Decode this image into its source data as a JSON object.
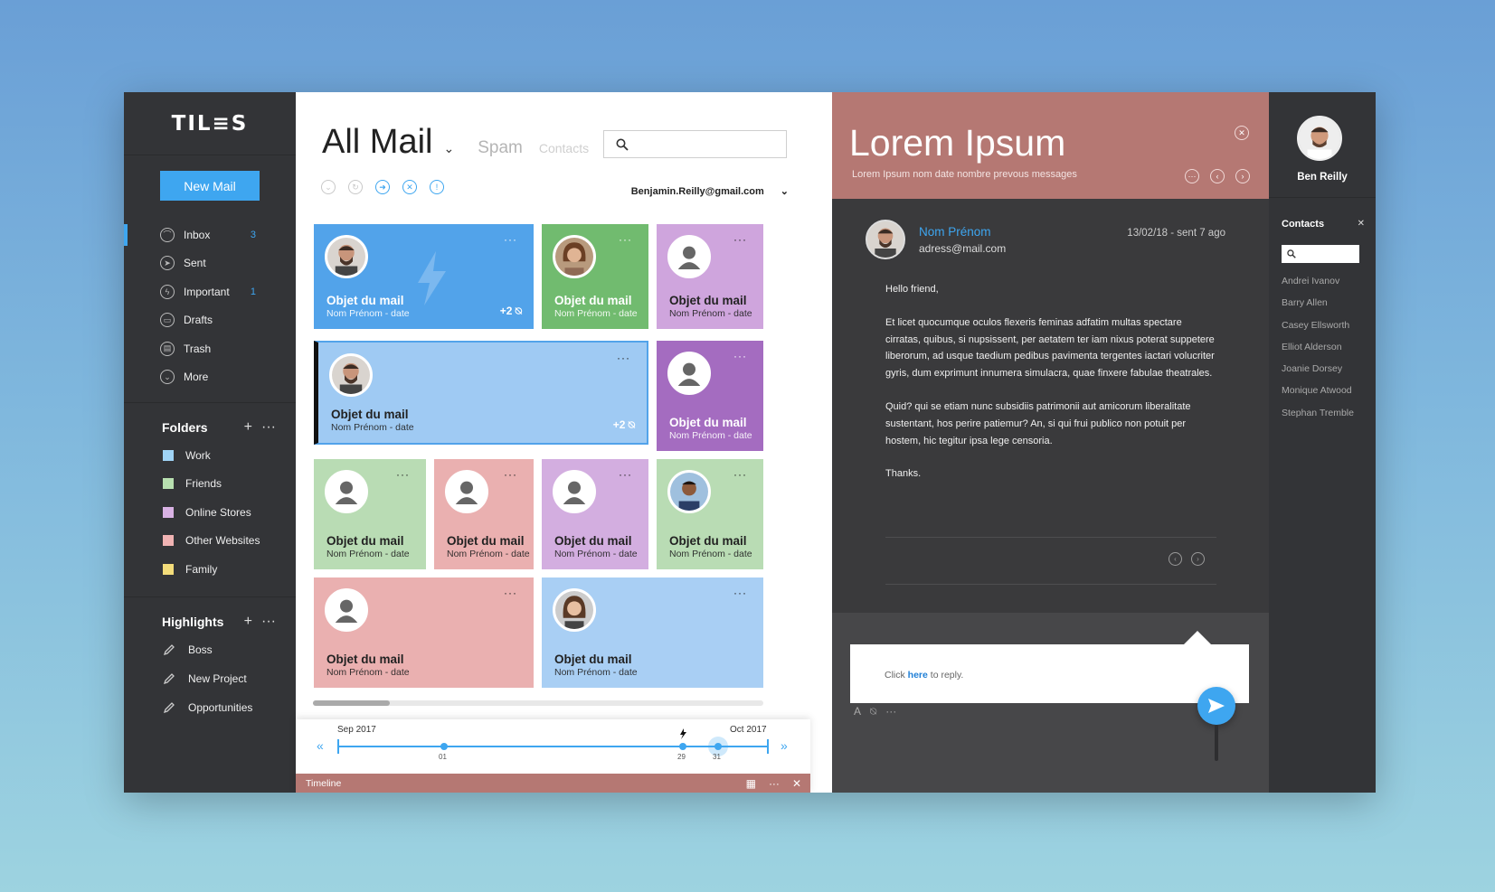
{
  "app": {
    "logo": "TIL≡S"
  },
  "sidebar": {
    "new_mail": "New Mail",
    "nav": [
      {
        "label": "Inbox",
        "count": "3",
        "icon": "inbox-icon"
      },
      {
        "label": "Sent",
        "count": "",
        "icon": "send-icon"
      },
      {
        "label": "Important",
        "count": "1",
        "icon": "important-icon"
      },
      {
        "label": "Drafts",
        "count": "",
        "icon": "drafts-icon"
      },
      {
        "label": "Trash",
        "count": "",
        "icon": "trash-icon"
      },
      {
        "label": "More",
        "count": "",
        "icon": "chevron-down-icon"
      }
    ],
    "folders_title": "Folders",
    "folders": [
      {
        "label": "Work",
        "color": "#9fd3f5"
      },
      {
        "label": "Friends",
        "color": "#b8e0b0"
      },
      {
        "label": "Online Stores",
        "color": "#d9b2e4"
      },
      {
        "label": "Other Websites",
        "color": "#f0b3b3"
      },
      {
        "label": "Family",
        "color": "#f3dc7a"
      }
    ],
    "highlights_title": "Highlights",
    "highlights": [
      {
        "label": "Boss"
      },
      {
        "label": "New Project"
      },
      {
        "label": "Opportunities"
      }
    ]
  },
  "main": {
    "title": "All Mail",
    "tab_spam": "Spam",
    "tab_contacts": "Contacts",
    "account": "Benjamin.Reilly@gmail.com",
    "tiles": [
      {
        "subject": "Objet du mail",
        "meta": "Nom Prénom - date",
        "attach": "+2",
        "color": "#52a3ea"
      },
      {
        "subject": "Objet du mail",
        "meta": "Nom Prénom - date",
        "attach": "",
        "color": "#71bb6f"
      },
      {
        "subject": "Objet du mail",
        "meta": "Nom Prénom - date",
        "attach": "",
        "color": "#cfa5dd"
      },
      {
        "subject": "Objet du mail",
        "meta": "Nom Prénom - date",
        "attach": "+2",
        "color": "#9fcaf3"
      },
      {
        "subject": "Objet du mail",
        "meta": "Nom Prénom - date",
        "attach": "",
        "color": "#a46cc0"
      },
      {
        "subject": "Objet du mail",
        "meta": "Nom Prénom - date",
        "attach": "",
        "color": "#b9dcb4"
      },
      {
        "subject": "Objet du mail",
        "meta": "Nom Prénom - date",
        "attach": "",
        "color": "#eab0b0"
      },
      {
        "subject": "Objet du mail",
        "meta": "Nom Prénom - date",
        "attach": "",
        "color": "#d3aee0"
      },
      {
        "subject": "Objet du mail",
        "meta": "Nom Prénom - date",
        "attach": "",
        "color": "#b9dcb4"
      },
      {
        "subject": "Objet du mail",
        "meta": "Nom Prénom - date",
        "attach": "",
        "color": "#eab0b0"
      },
      {
        "subject": "Objet du mail",
        "meta": "Nom Prénom - date",
        "attach": "",
        "color": "#a9cff4"
      }
    ],
    "more_glyph": "···",
    "timeline": {
      "label": "Timeline",
      "start_label": "Sep 2017",
      "end_label": "Oct 2017",
      "ticks": [
        "01",
        "29",
        "31"
      ]
    }
  },
  "reader": {
    "title": "Lorem Ipsum",
    "subtitle": "Lorem Ipsum nom date nombre prevous messages",
    "sender": "Nom Prénom",
    "address": "adress@mail.com",
    "date": "13/02/18 - sent 7 ago",
    "body": [
      "Hello friend,",
      "Et licet quocumque oculos flexeris feminas adfatim multas spectare cirratas, quibus, si nupsissent, per aetatem ter iam nixus poterat suppetere liberorum, ad usque taedium pedibus pavimenta tergentes iactari volucriter gyris, dum exprimunt innumera simulacra, quae finxere fabulae theatrales.",
      "Quid? qui se etiam nunc subsidiis patrimonii aut amicorum liberalitate sustentant, hos perire patiemur? An, si qui frui publico non potuit per hostem, hic tegitur ipsa lege censoria.",
      "Thanks."
    ],
    "reply_prefix": "Click ",
    "reply_link": "here",
    "reply_suffix": " to reply."
  },
  "contacts": {
    "user": "Ben Reilly",
    "title": "Contacts",
    "list": [
      "Andrei Ivanov",
      "Barry Allen",
      "Casey Ellsworth",
      "Elliot Alderson",
      "Joanie Dorsey",
      "Monique Atwood",
      "Stephan Tremble"
    ]
  }
}
